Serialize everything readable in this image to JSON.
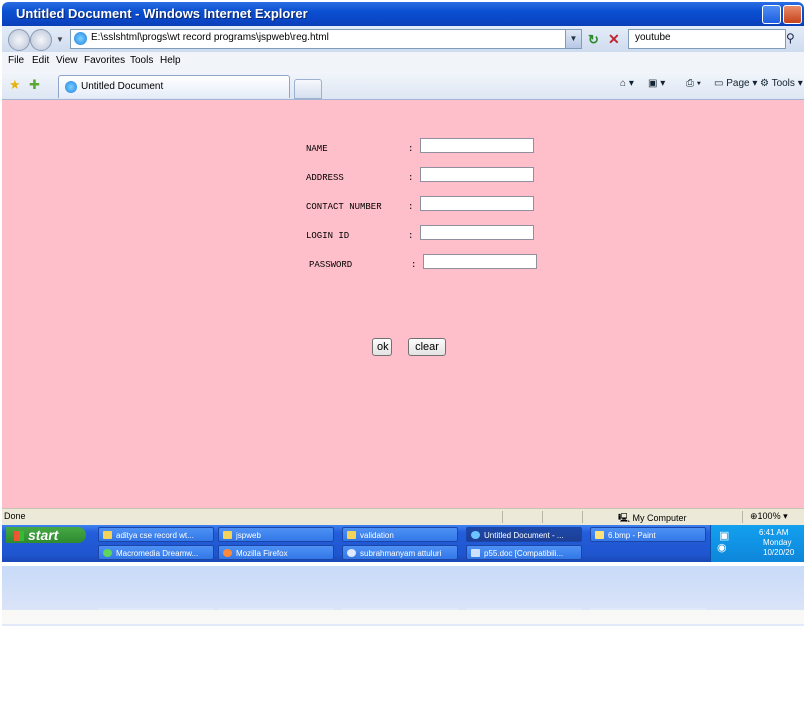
{
  "window": {
    "title": "Untitled Document - Windows Internet Explorer"
  },
  "address_bar": {
    "url": "E:\\sslshtml\\progs\\wt record programs\\jspweb\\reg.html",
    "search_value": "youtube"
  },
  "menu": [
    "File",
    "Edit",
    "View",
    "Favorites",
    "Tools",
    "Help"
  ],
  "tab": {
    "title": "Untitled Document"
  },
  "command_bar": {
    "page_label": "Page",
    "tools_label": "Tools"
  },
  "form": {
    "fields": [
      {
        "label": "NAME",
        "separator": ":"
      },
      {
        "label": "ADDRESS",
        "separator": ":"
      },
      {
        "label": "CONTACT NUMBER",
        "separator": ":"
      },
      {
        "label": "LOGIN ID",
        "separator": ":"
      },
      {
        "label": "PASSWORD",
        "separator": ":"
      }
    ],
    "ok_label": "ok",
    "clear_label": "clear"
  },
  "status_bar": {
    "status": "Done",
    "zone": "My Computer",
    "zoom": "100%"
  },
  "taskbar": {
    "start_label": "start",
    "row1": [
      {
        "label": "aditya cse record wt...",
        "active": false
      },
      {
        "label": "jspweb",
        "active": false
      },
      {
        "label": "validation",
        "active": false
      },
      {
        "label": "Untitled Document - ...",
        "active": true
      },
      {
        "label": "6.bmp - Paint",
        "active": false
      }
    ],
    "row2": [
      {
        "label": "Macromedia Dreamw...",
        "active": false
      },
      {
        "label": "Mozilla Firefox",
        "active": false
      },
      {
        "label": "subrahmanyam attuluri",
        "active": false
      },
      {
        "label": "p55.doc [Compatibili...",
        "active": false
      }
    ],
    "clock": {
      "time": "6:41 AM",
      "day": "Monday",
      "date": "10/20/20"
    }
  },
  "colors": {
    "page_background": "#ffbfca",
    "titlebar": "#0a4fd1",
    "taskbar": "#245edb",
    "start_button": "#3b9a3b"
  }
}
